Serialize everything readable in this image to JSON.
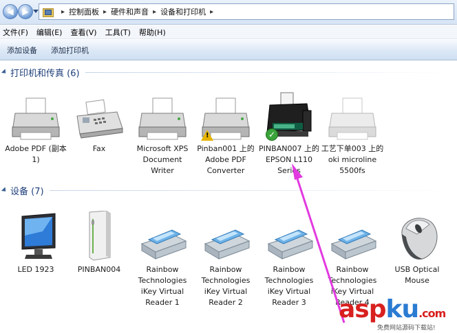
{
  "address_bar": {
    "breadcrumbs": [
      "控制面板",
      "硬件和声音",
      "设备和打印机"
    ]
  },
  "menu": {
    "items": [
      "文件(F)",
      "编辑(E)",
      "查看(V)",
      "工具(T)",
      "帮助(H)"
    ]
  },
  "toolbar": {
    "buttons": [
      "添加设备",
      "添加打印机"
    ]
  },
  "printers_group": {
    "title": "打印机和传真 (6)",
    "items": [
      {
        "label": "Adobe PDF (副本 1)",
        "icon": "printer-icon"
      },
      {
        "label": "Fax",
        "icon": "fax-icon"
      },
      {
        "label": "Microsoft XPS Document Writer",
        "icon": "printer-icon"
      },
      {
        "label": "Pinban001 上的 Adobe PDF Converter",
        "icon": "printer-icon",
        "badge": "warning"
      },
      {
        "label": "PINBAN007 上的 EPSON L110 Series",
        "icon": "epson-printer-icon",
        "badge": "default"
      },
      {
        "label": "工艺下单003 上的 oki microline 5500fs",
        "icon": "printer-icon"
      }
    ]
  },
  "devices_group": {
    "title": "设备 (7)",
    "items": [
      {
        "label": "LED 1923",
        "icon": "monitor-icon"
      },
      {
        "label": "PINBAN004",
        "icon": "computer-icon"
      },
      {
        "label": "Rainbow Technologies iKey Virtual Reader 1",
        "icon": "card-reader-icon"
      },
      {
        "label": "Rainbow Technologies iKey Virtual Reader 2",
        "icon": "card-reader-icon"
      },
      {
        "label": "Rainbow Technologies iKey Virtual Reader 3",
        "icon": "card-reader-icon"
      },
      {
        "label": "Rainbow Technologies iKey Virtual Reader 4",
        "icon": "card-reader-icon"
      },
      {
        "label": "USB Optical Mouse",
        "icon": "mouse-icon"
      }
    ]
  },
  "watermark": {
    "main_asp": "asp",
    "main_ku": "ku",
    "main_suffix": ".com",
    "sub": "免费网站源码下载站!"
  },
  "colors": {
    "group_title": "#1e3f7a",
    "annotation_arrow": "#e23ae0"
  }
}
